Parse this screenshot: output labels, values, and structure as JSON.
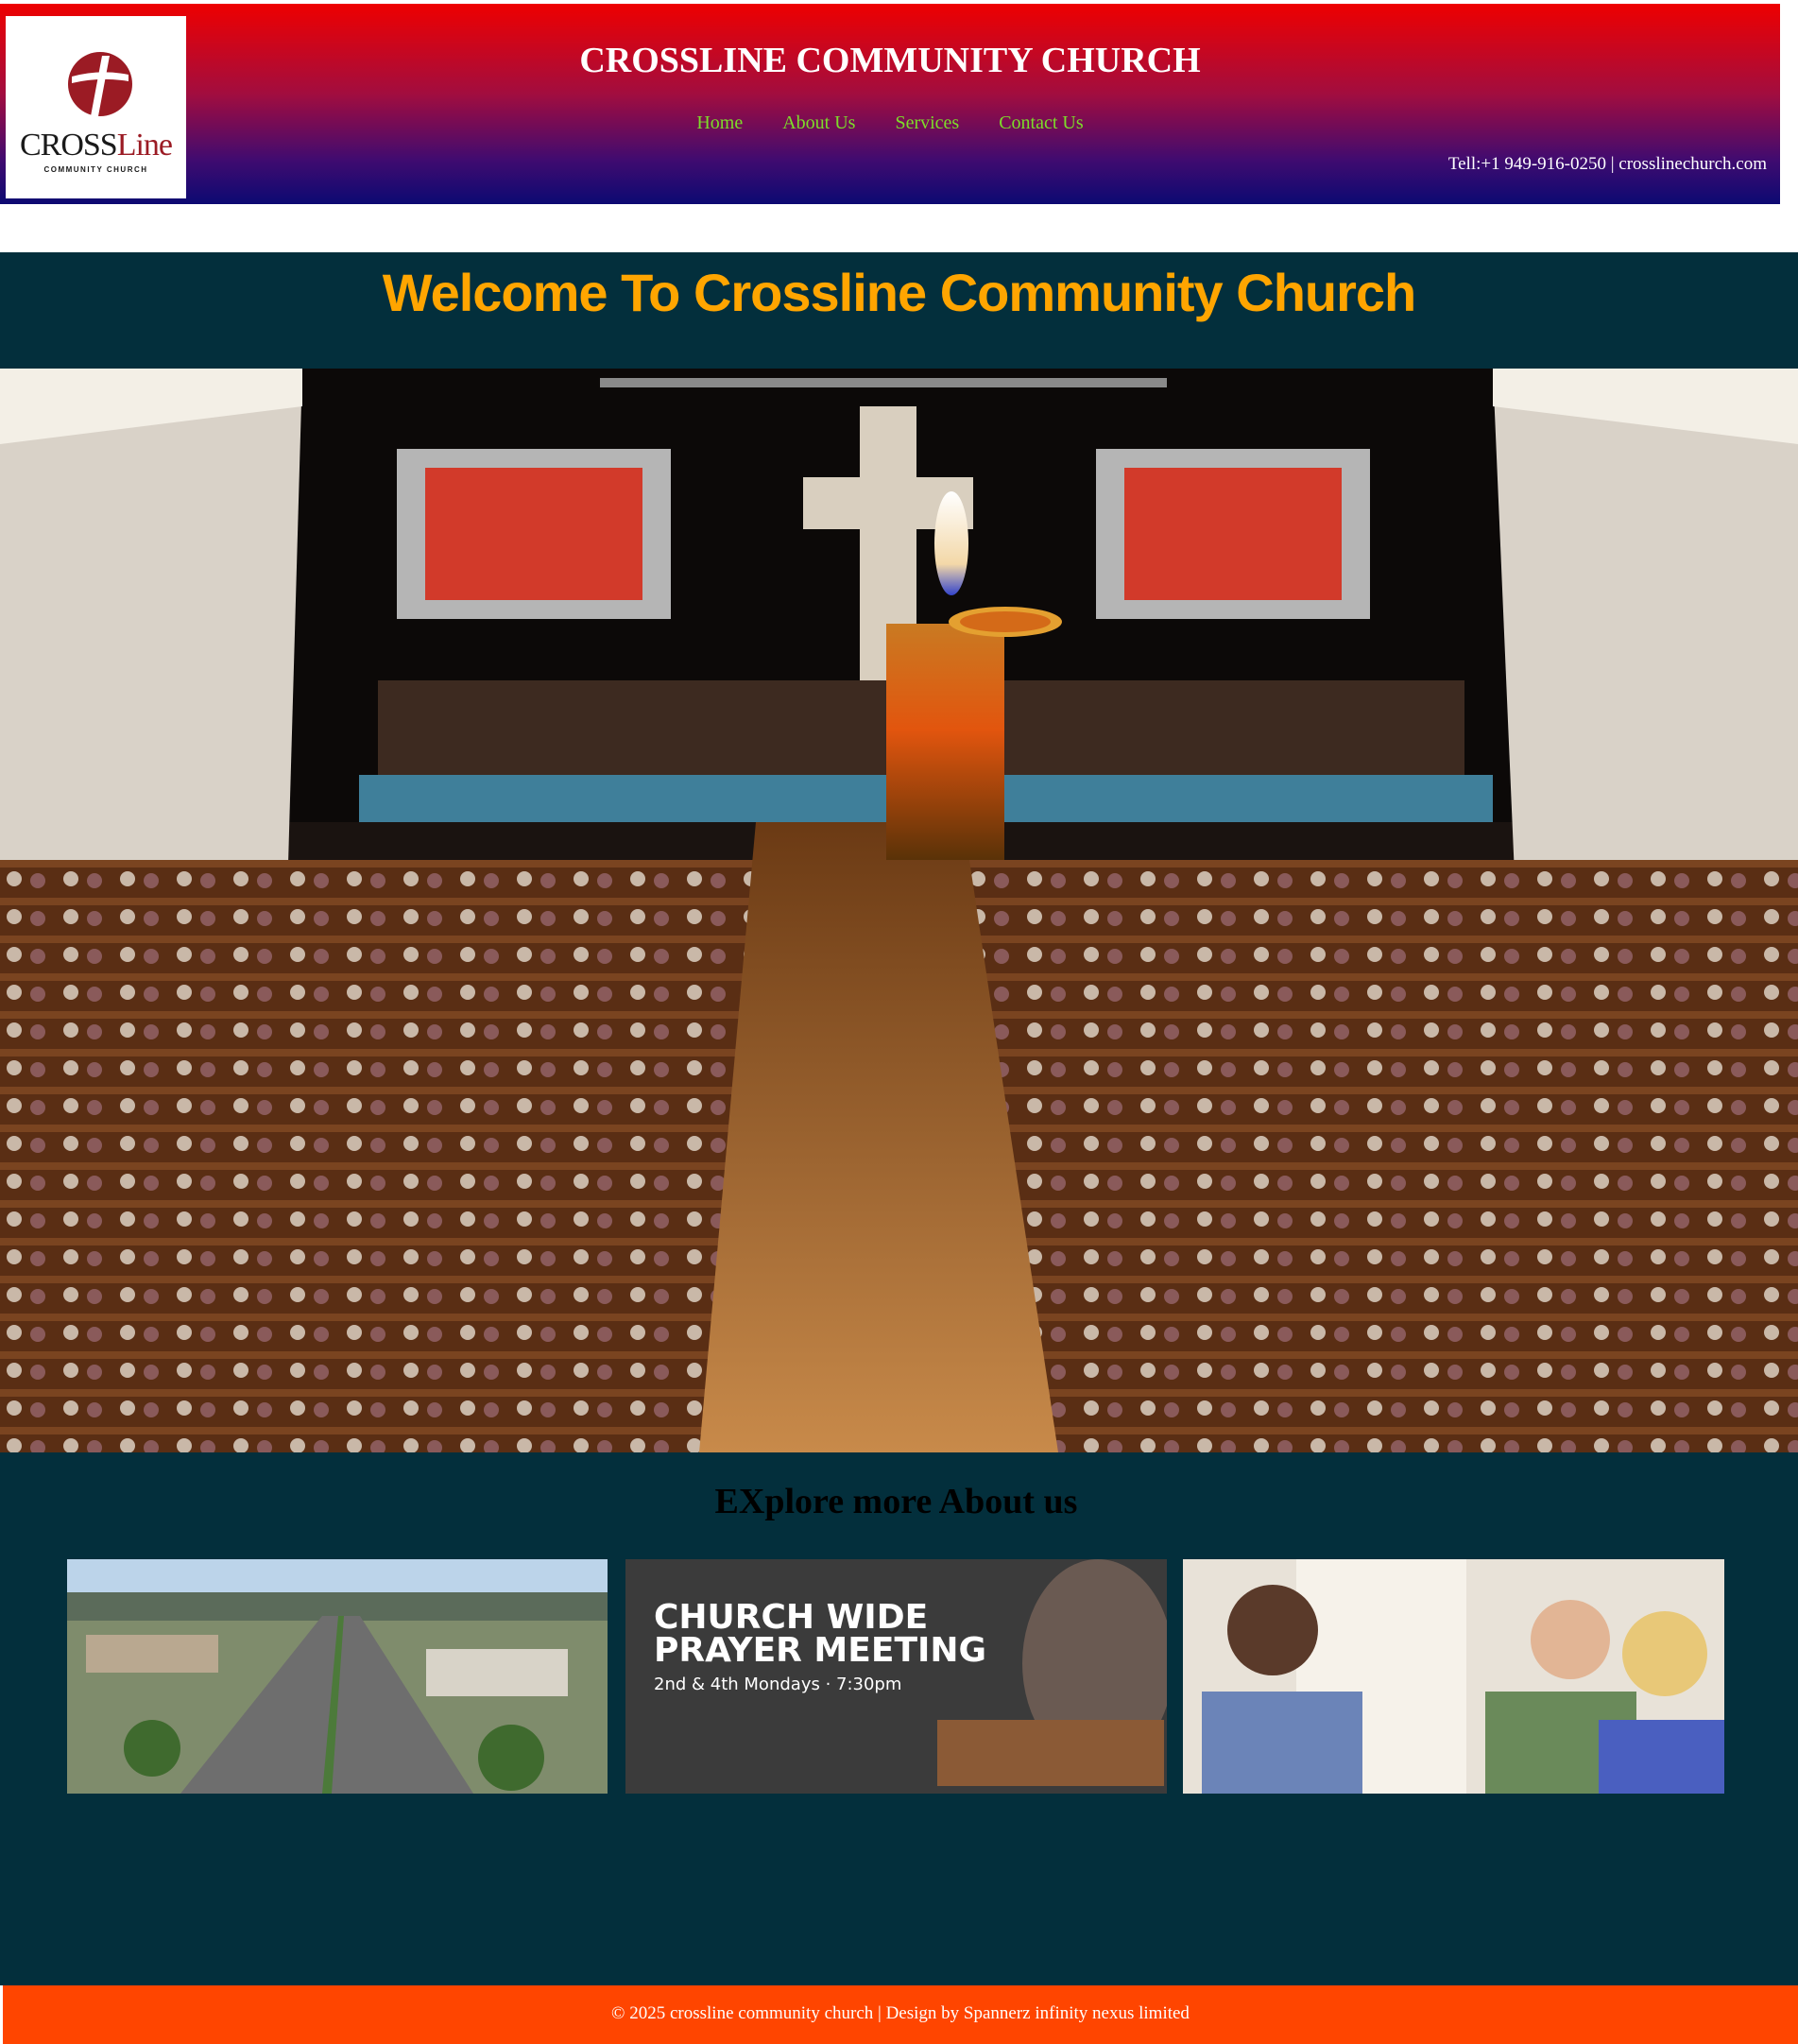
{
  "header": {
    "logo": {
      "wordmark_left": "CROSS",
      "wordmark_right": "Line",
      "subtext": "COMMUNITY CHURCH",
      "icon": "cross-circle-icon"
    },
    "title": "CROSSLINE COMMUNITY CHURCH",
    "nav": [
      "Home",
      "About Us",
      "Services",
      "Contact Us"
    ],
    "contact": "Tell:+1 949-916-0250 | crosslinechurch.com"
  },
  "main": {
    "welcome": "Welcome To Crossline Community Church",
    "explore_heading": "EXplore more About us",
    "cards": [
      {
        "name": "aerial-city-photo",
        "title": "",
        "subtitle": ""
      },
      {
        "name": "prayer-meeting-banner",
        "title_line1": "CHURCH WIDE",
        "title_line2": "PRAYER MEETING",
        "subtitle": "2nd & 4th Mondays · 7:30pm"
      },
      {
        "name": "people-conversation-photo",
        "title": "",
        "subtitle": ""
      }
    ]
  },
  "footer": {
    "text": "© 2025 crossline community church | Design by Spannerz infinity nexus limited"
  },
  "colors": {
    "header_top": "#ee0000",
    "header_bottom": "#0c0a72",
    "nav_link": "#7ddc2a",
    "main_bg": "#032f3c",
    "welcome": "#ffa500",
    "footer_bg": "#ff4500"
  }
}
